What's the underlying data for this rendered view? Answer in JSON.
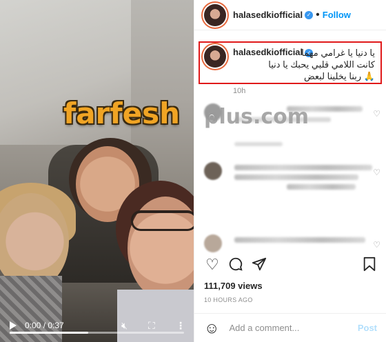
{
  "video": {
    "time": "0:00 / 0:37",
    "progress": 0.45,
    "icons": [
      "play-icon",
      "mute-icon",
      "fullscreen-icon",
      "more-icon"
    ]
  },
  "watermark": {
    "brand": "farfesh",
    "suffix": "plus.com"
  },
  "header": {
    "username": "halasedkiofficial",
    "separator": "•",
    "follow_label": "Follow"
  },
  "caption": {
    "username": "halasedkiofficial",
    "line1": "يا دنيا يا غرامي مهما",
    "line2": "كانت اللامي قلبي يحبك يا دنيا",
    "line3": "ربنا يخلينا لبعض",
    "emoji": "🙏",
    "time": "10h"
  },
  "actions": {
    "icons": [
      "heart-icon",
      "comment-icon",
      "share-icon",
      "save-icon"
    ]
  },
  "post": {
    "views": "111,709 views",
    "posted": "10 HOURS AGO"
  },
  "comment_input": {
    "placeholder": "Add a comment...",
    "post_label": "Post"
  },
  "colors": {
    "follow": "#0095f6",
    "highlight_border": "#e0191a",
    "verified": "#3897f0",
    "watermark": "#f0a424"
  }
}
